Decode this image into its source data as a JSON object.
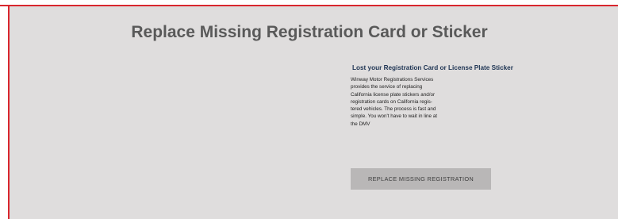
{
  "page": {
    "title": "Replace Missing Registration Card or Sticker"
  },
  "info": {
    "heading": "Lost your Registration Card or License Plate Sticker",
    "description_lines": [
      "Winway Motor Registrations Services",
      "provides the service of replacing",
      "California license plate stickers and/or",
      "registration cards on California regis-",
      "tered vehicles. The process is fast and",
      "simple. You won't have to wait in line at",
      "the DMV"
    ]
  },
  "cta": {
    "label": "REPLACE MISSING REGISTRATION"
  },
  "colors": {
    "accent_border": "#d9272e",
    "panel_background": "#dfdddd",
    "title_text": "#595959",
    "heading_text": "#1e3453",
    "button_background": "#b9b7b7"
  }
}
